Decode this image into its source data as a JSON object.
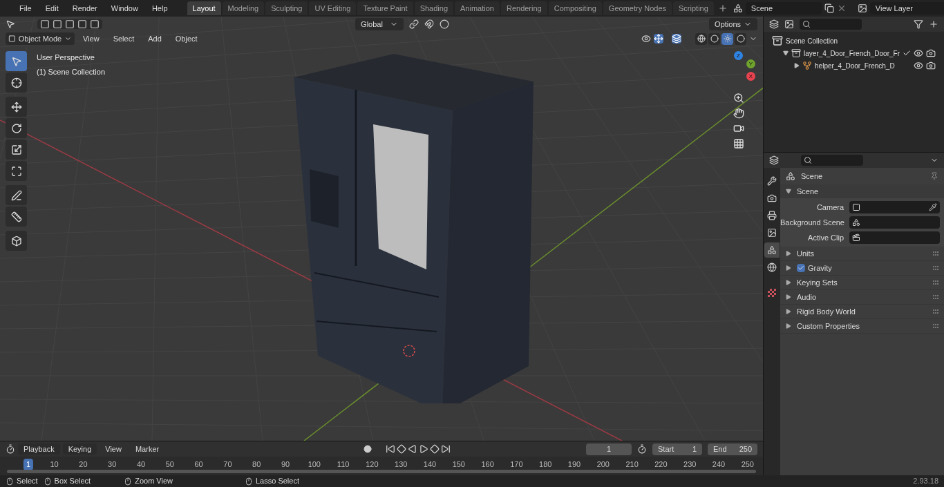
{
  "menu": [
    "File",
    "Edit",
    "Render",
    "Window",
    "Help"
  ],
  "workspaces": [
    {
      "label": "Layout",
      "selected": true
    },
    {
      "label": "Modeling",
      "selected": false
    },
    {
      "label": "Sculpting",
      "selected": false
    },
    {
      "label": "UV Editing",
      "selected": false
    },
    {
      "label": "Texture Paint",
      "selected": false
    },
    {
      "label": "Shading",
      "selected": false
    },
    {
      "label": "Animation",
      "selected": false
    },
    {
      "label": "Rendering",
      "selected": false
    },
    {
      "label": "Compositing",
      "selected": false
    },
    {
      "label": "Geometry Nodes",
      "selected": false
    },
    {
      "label": "Scripting",
      "selected": false
    }
  ],
  "scene": {
    "name": "Scene"
  },
  "view_layer": {
    "name": "View Layer"
  },
  "viewport": {
    "transform_orientation": "Global",
    "options": "Options",
    "mode": "Object Mode",
    "menus": [
      "View",
      "Select",
      "Add",
      "Object"
    ],
    "overlay_text": [
      "User Perspective",
      "(1) Scene Collection"
    ],
    "tools": [
      {
        "kind": "select_box",
        "selected": true
      },
      {
        "kind": "cursor",
        "selected": false
      },
      {
        "kind": "move",
        "selected": false
      },
      {
        "kind": "rotate",
        "selected": false
      },
      {
        "kind": "scale",
        "selected": false
      },
      {
        "kind": "transform",
        "selected": false
      },
      {
        "kind": "annotate",
        "selected": false
      },
      {
        "kind": "measure",
        "selected": false
      },
      {
        "kind": "add_cube",
        "selected": false
      }
    ],
    "shading": [
      {
        "kind": "wireframe",
        "selected": false
      },
      {
        "kind": "solid",
        "selected": false
      },
      {
        "kind": "material",
        "selected": true
      },
      {
        "kind": "rendered",
        "selected": false
      }
    ],
    "gizmo_axes": [
      "Z",
      "Y",
      "X"
    ]
  },
  "outliner": {
    "items": [
      {
        "label": "Scene Collection",
        "children": [
          {
            "label": "layer_4_Door_French_Door_Fr",
            "expanded": true,
            "checked": true,
            "children": [
              {
                "label": "helper_4_Door_French_D",
                "expanded": false
              }
            ]
          }
        ]
      }
    ]
  },
  "properties": {
    "tabs": [
      {
        "kind": "tool",
        "selected": false
      },
      {
        "kind": "render",
        "selected": false
      },
      {
        "kind": "output",
        "selected": false
      },
      {
        "kind": "view_layer",
        "selected": false
      },
      {
        "kind": "scene",
        "selected": true
      },
      {
        "kind": "world",
        "selected": false
      },
      {
        "kind": "texture",
        "selected": false
      }
    ],
    "title": "Scene",
    "section": "Scene",
    "fields": [
      {
        "label": "Camera"
      },
      {
        "label": "Background Scene"
      },
      {
        "label": "Active Clip"
      }
    ],
    "panels": [
      {
        "kind": "plain",
        "label": "Units"
      },
      {
        "kind": "checkbox",
        "label": "Gravity",
        "checked": true
      },
      {
        "kind": "plain",
        "label": "Keying Sets"
      },
      {
        "kind": "plain",
        "label": "Audio"
      },
      {
        "kind": "plain",
        "label": "Rigid Body World"
      },
      {
        "kind": "plain",
        "label": "Custom Properties"
      }
    ]
  },
  "timeline": {
    "menus": [
      "Playback",
      "Keying",
      "View",
      "Marker"
    ],
    "current_frame": "1",
    "start_label": "Start",
    "start": "1",
    "end_label": "End",
    "end": "250",
    "ruler": [
      "1",
      "10",
      "20",
      "30",
      "40",
      "50",
      "60",
      "70",
      "80",
      "90",
      "100",
      "110",
      "120",
      "130",
      "140",
      "150",
      "160",
      "170",
      "180",
      "190",
      "200",
      "210",
      "220",
      "230",
      "240",
      "250"
    ]
  },
  "status_bar": {
    "hints": [
      "Select",
      "Box Select",
      "Zoom View",
      "Lasso Select"
    ],
    "version": "2.93.18"
  }
}
